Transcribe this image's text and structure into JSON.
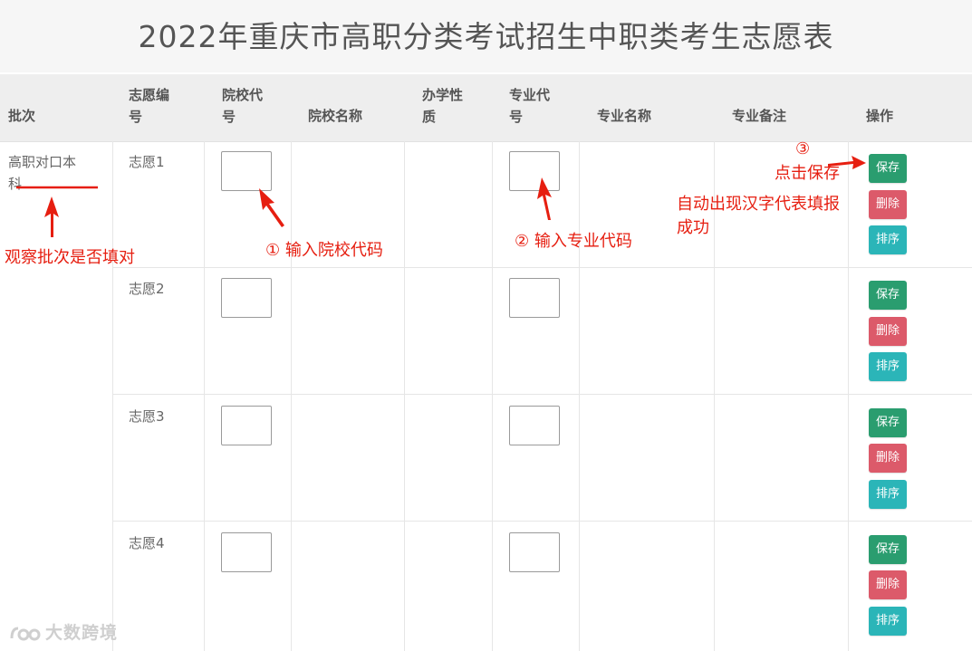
{
  "page": {
    "title": "2022年重庆市高职分类考试招生中职类考生志愿表"
  },
  "table": {
    "headers": {
      "batch": [
        "批次"
      ],
      "wish_no": [
        "志愿编",
        "号"
      ],
      "school_code": [
        "院校代",
        "号"
      ],
      "school_name": [
        "院校名称"
      ],
      "school_type": [
        "办学性",
        "质"
      ],
      "major_code": [
        "专业代",
        "号"
      ],
      "major_name": [
        "专业名称"
      ],
      "major_note": [
        "专业备注"
      ],
      "actions": [
        "操作"
      ]
    },
    "batch_value": [
      "高职对口本",
      "科"
    ],
    "rows": [
      {
        "wish": "志愿1"
      },
      {
        "wish": "志愿2"
      },
      {
        "wish": "志愿3"
      },
      {
        "wish": "志愿4"
      }
    ],
    "buttons": {
      "save": "保存",
      "delete": "删除",
      "sort": "排序"
    },
    "button_colors": {
      "save": "#2a9d6f",
      "delete": "#dc5a6a",
      "sort": "#2bb5b8"
    }
  },
  "annotations": {
    "check_batch": "观察批次是否填对",
    "step1": "① 输入院校代码",
    "step2": "② 输入专业代码",
    "step3_num": "③",
    "step3_text": "点击保存",
    "auto_fill": [
      "自动出现汉字代表填报",
      "成功"
    ],
    "color": "#e61e10"
  },
  "watermark": {
    "text": "大数跨境",
    "icon": "watermark-logo-icon"
  }
}
